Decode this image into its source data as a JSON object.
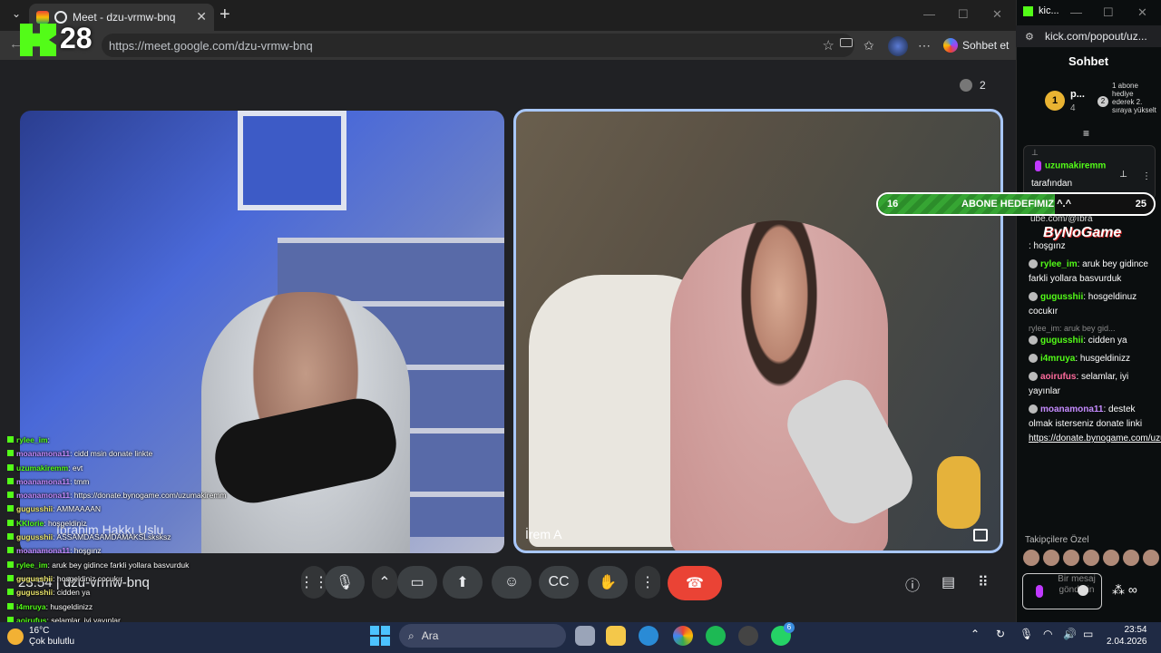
{
  "browser": {
    "tab_title": "Meet - dzu-vrmw-bnq",
    "new_tab": "+",
    "url": "https://meet.google.com/dzu-vrmw-bnq",
    "sohbet_label": "Sohbet et"
  },
  "kick_overlay": {
    "viewer_count": "28"
  },
  "meet": {
    "participants_count": "2",
    "left_name": "İbrahim Hakkı Uslu",
    "right_name": "İrem A",
    "time": "23:54",
    "meeting_code": "dzu-vrmw-bnq"
  },
  "overlay_chat": [
    {
      "user": "rylee_im",
      "text": ": ",
      "color": "g"
    },
    {
      "user": "moanamona11",
      "text": ": cidd msin donate linkte",
      "color": "p"
    },
    {
      "user": "uzumakiremm",
      "text": ": evt",
      "color": "g"
    },
    {
      "user": "moanamona11",
      "text": ": tmm",
      "color": "p"
    },
    {
      "user": "moanamona11",
      "text": ": https://donate.bynogame.com/uzumakiremm",
      "color": "p"
    },
    {
      "user": "gugusshii",
      "text": ": AMMAAAAN",
      "color": "y"
    },
    {
      "user": "KKlorie",
      "text": ": hoşgeldiniz",
      "color": "g"
    },
    {
      "user": "gugusshii",
      "text": ": ASSAMDASAMDAMAKSLsksksz",
      "color": "y"
    },
    {
      "user": "moanamona11",
      "text": ": hoşgınz",
      "color": "p"
    },
    {
      "user": "rylee_im",
      "text": ": aruk bey gidince farkli yollara basvurduk",
      "color": "g"
    },
    {
      "user": "gugusshii",
      "text": ": hosgeldiniz cocukır",
      "color": "y"
    },
    {
      "user": "gugusshii",
      "text": ": cidden ya",
      "color": "y"
    },
    {
      "user": "i4mruya",
      "text": ": husgeldinizz",
      "color": "g"
    },
    {
      "user": "aoirufus",
      "text": ": selamlar, iyi yayınlar",
      "color": "g"
    },
    {
      "user": "moanamona11",
      "text": ": destek olmak isterseniz donate linki",
      "color": "p"
    },
    {
      "user": "",
      "text": "https://donate.bynogame.com/uzumakiremm",
      "color": "p"
    }
  ],
  "taskbar": {
    "weather_temp": "16°C",
    "weather_desc": "Çok bulutlu",
    "search_placeholder": "Ara",
    "whatsapp_badge": "6",
    "time": "23:54",
    "date": "2.04.2026"
  },
  "kick_panel": {
    "window_title": "kic...",
    "url": "kick.com/popout/uz...",
    "header": "Sohbet",
    "top_name": "p...",
    "top_sub": "4",
    "top_rank": "1",
    "second_rank": "2",
    "side_text": "1 abone hediye ederek 2. sıraya yükselt",
    "pinned_user": "uzumakiremm",
    "pinned_text": "tarafından",
    "pinned_tail": "lendi s://www.yout ube.com/@ıbra",
    "pinned_tail2": ": hoşgınz",
    "goal_current": "16",
    "goal_label": "ABONE HEDEFIMIZ ^.^",
    "goal_target": "25",
    "bng_text": "ByNoGame",
    "messages": [
      {
        "user": "rylee_im",
        "text": ": aruk bey gidince farkli yollara basvurduk",
        "cls": "g"
      },
      {
        "user": "gugusshii",
        "text": ": hosgeldinuz cocukır",
        "cls": "g"
      },
      {
        "reply": "rylee_im: aruk bey gid...",
        "user": "gugusshii",
        "text": ": cidden ya",
        "cls": "g"
      },
      {
        "user": "i4mruya",
        "text": ": husgeldinizz",
        "cls": "g"
      },
      {
        "user": "aoirufus",
        "text": ": selamlar, iyi yayınlar",
        "cls": "r"
      },
      {
        "user": "moanamona11",
        "text": ": destek olmak isterseniz donate linki",
        "link": "https://donate.bynogame.com/uzumakiremm",
        "cls": "p"
      }
    ],
    "followers_label": "Takipçilere Özel",
    "input_placeholder": "Bir mesaj gönderin"
  },
  "colors": {
    "kick_green": "#53fc18",
    "end_call_red": "#ea4335",
    "meet_bg": "#202124",
    "active_tile_border": "#a8c7fa"
  },
  "goal_progress": 0.64
}
